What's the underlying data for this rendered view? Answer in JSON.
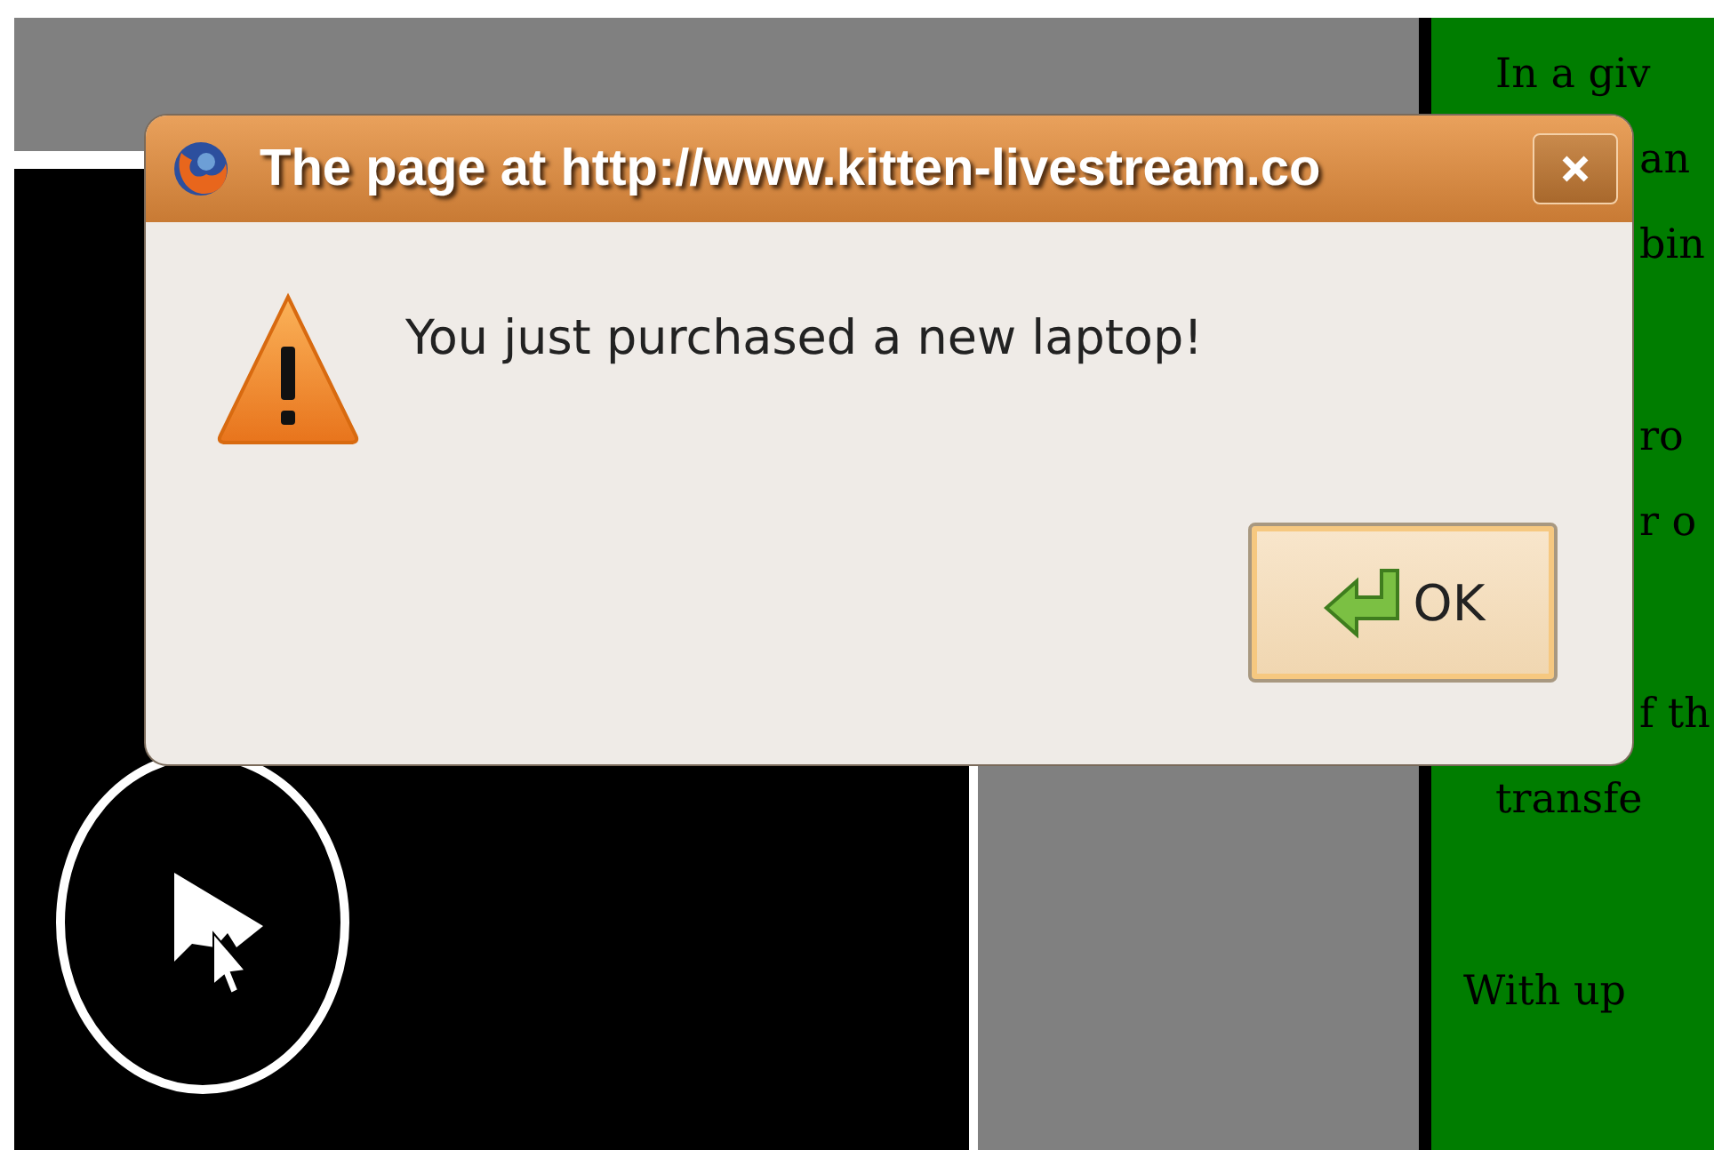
{
  "dialog": {
    "title": "The page at http://www.kitten-livestream.co",
    "message": "You just purchased a new laptop!",
    "buttons": [
      "OK"
    ]
  },
  "side_text": {
    "paragraphs": [
      {
        "kind": "body",
        "lines": [
          {
            "kind": "start",
            "text": "In a giv"
          },
          {
            "kind": "fragment",
            "text": "an"
          },
          {
            "kind": "fragment",
            "text": "bin"
          }
        ]
      },
      {
        "kind": "body",
        "lines": [
          {
            "kind": "fragment",
            "text": "ro"
          },
          {
            "kind": "fragment",
            "text": "r o"
          }
        ]
      },
      {
        "kind": "body",
        "lines": [
          {
            "kind": "fragment",
            "text": "f th"
          },
          {
            "kind": "start",
            "text": "transfe"
          }
        ]
      },
      {
        "kind": "note",
        "lines": [
          {
            "kind": "start",
            "text": "With up"
          }
        ]
      }
    ]
  }
}
